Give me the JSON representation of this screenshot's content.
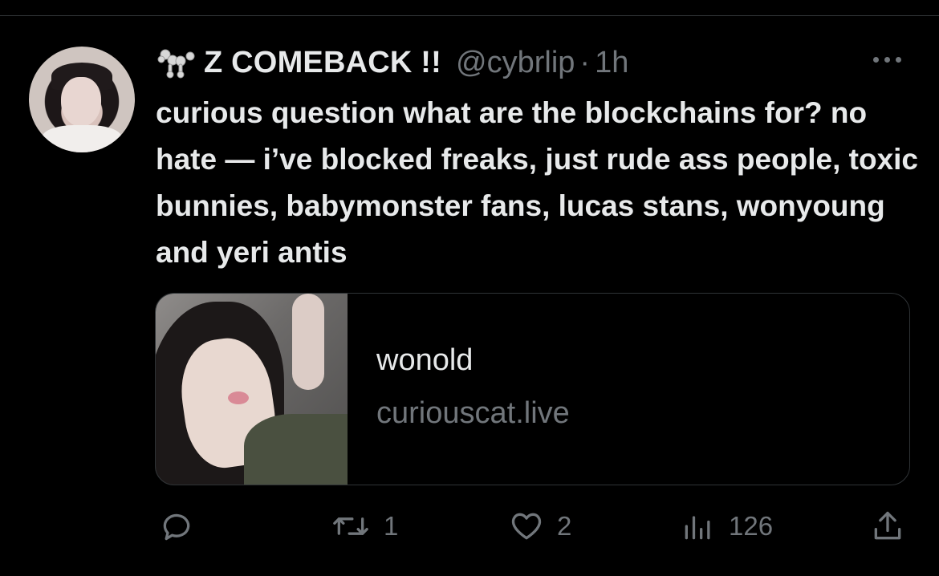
{
  "tweet": {
    "display_name": "Z COMEBACK !!",
    "handle": "@cybrlip",
    "separator": "·",
    "time": "1h",
    "text": "curious question what are the blockchains for? no hate — i’ve blocked freaks, just rude ass people, toxic bunnies, babymonster fans, lucas stans, wonyoung and yeri antis"
  },
  "card": {
    "title": "wonold",
    "domain": "curiouscat.live"
  },
  "actions": {
    "reply_count": "",
    "retweet_count": "1",
    "like_count": "2",
    "views_count": "126"
  },
  "icons": {
    "name_emoji": "poodle-icon",
    "more": "more-icon",
    "reply": "reply-icon",
    "retweet": "retweet-icon",
    "like": "heart-icon",
    "views": "views-icon",
    "share": "share-icon"
  },
  "colors": {
    "background": "#000000",
    "primary_text": "#e7e9ea",
    "secondary_text": "#71767b",
    "border": "#2f3336"
  }
}
